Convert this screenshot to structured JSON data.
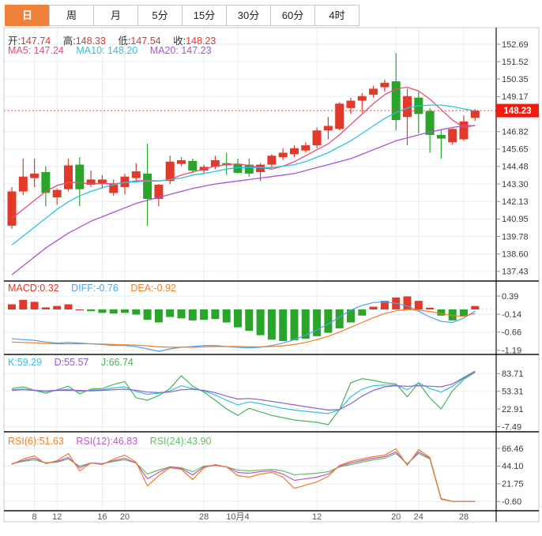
{
  "tabs": [
    {
      "label": "日",
      "active": true
    },
    {
      "label": "周",
      "active": false
    },
    {
      "label": "月",
      "active": false
    },
    {
      "label": "5分",
      "active": false
    },
    {
      "label": "15分",
      "active": false
    },
    {
      "label": "30分",
      "active": false
    },
    {
      "label": "60分",
      "active": false
    },
    {
      "label": "4时",
      "active": false
    }
  ],
  "header": {
    "open_label": "开:",
    "open": "147.74",
    "high_label": "高:",
    "high": "148.33",
    "low_label": "低:",
    "low": "147.54",
    "close_label": "收:",
    "close": "148.23",
    "ma5_label": "MA5: ",
    "ma5": "147.24",
    "ma10_label": "MA10: ",
    "ma10": "148.20",
    "ma20_label": "MA20: ",
    "ma20": "147.23"
  },
  "indicators": {
    "macd": "MACD:0.32",
    "diff": "DIFF:-0.76",
    "dea": "DEA:-0.92",
    "k": "K:59.29",
    "d": "D:55.57",
    "j": "J:66.74",
    "rsi6": "RSI(6):51.63",
    "rsi12": "RSI(12):46.83",
    "rsi24": "RSI(24):43.90"
  },
  "colors": {
    "up": "#e13a2b",
    "down": "#2aa52a",
    "ma5": "#ec4a71",
    "ma10": "#27c4e2",
    "ma20": "#ad52d6",
    "diff": "#4da2ee",
    "dea": "#f57b1f",
    "macd_text": "#e8312a",
    "k": "#2fc2de",
    "d": "#8a5fd0",
    "j": "#4cb05c",
    "rsi6": "#f07e28",
    "rsi12": "#bb58c9",
    "rsi24": "#69bd69",
    "badge": "#ee1c0f",
    "price_line": "#e84040",
    "grid": "#e3edf3",
    "frame": "#c9c9c9",
    "separator": "#111111",
    "axis_text": "#3a3a3a",
    "xaxis_text": "#555555",
    "ohlc_label": "#333333",
    "ohlc_value": "#e8312a",
    "tab_active_bg": "#ef8138",
    "macd_zero": "#a8d8ea"
  },
  "chart_data": {
    "type": "candlestick",
    "price_line": "148.23",
    "candles": [
      [
        140.5,
        143.1,
        140.3,
        142.8
      ],
      [
        142.8,
        145.0,
        142.55,
        143.8
      ],
      [
        143.7,
        145.0,
        143.1,
        144.0
      ],
      [
        144.1,
        144.5,
        141.8,
        142.7
      ],
      [
        142.4,
        143.0,
        141.9,
        142.9
      ],
      [
        142.95,
        145.0,
        142.8,
        144.55
      ],
      [
        144.6,
        145.1,
        141.8,
        142.95
      ],
      [
        143.25,
        144.2,
        143.1,
        143.6
      ],
      [
        143.3,
        143.9,
        143.0,
        143.6
      ],
      [
        142.7,
        143.6,
        142.5,
        143.35
      ],
      [
        143.1,
        144.0,
        142.6,
        143.8
      ],
      [
        143.7,
        144.7,
        143.4,
        144.15
      ],
      [
        144.0,
        146.0,
        140.5,
        142.3
      ],
      [
        142.3,
        143.3,
        141.8,
        143.25
      ],
      [
        143.5,
        145.2,
        143.3,
        144.8
      ],
      [
        144.65,
        145.1,
        144.5,
        144.9
      ],
      [
        144.85,
        145.0,
        144.1,
        144.2
      ],
      [
        144.2,
        144.6,
        144.0,
        144.45
      ],
      [
        144.45,
        145.2,
        144.3,
        144.9
      ],
      [
        144.7,
        145.4,
        143.9,
        144.55
      ],
      [
        144.65,
        145.0,
        144.0,
        144.05
      ],
      [
        144.6,
        145.0,
        143.8,
        144.0
      ],
      [
        144.1,
        144.7,
        143.5,
        144.6
      ],
      [
        144.6,
        145.3,
        144.4,
        145.2
      ],
      [
        145.1,
        145.7,
        144.9,
        145.4
      ],
      [
        145.3,
        145.9,
        145.1,
        145.7
      ],
      [
        145.55,
        146.1,
        145.4,
        145.9
      ],
      [
        145.9,
        147.1,
        145.7,
        146.9
      ],
      [
        146.9,
        147.8,
        146.3,
        147.2
      ],
      [
        147.0,
        148.8,
        146.9,
        148.7
      ],
      [
        148.4,
        149.1,
        148.0,
        148.9
      ],
      [
        148.9,
        149.4,
        148.1,
        149.2
      ],
      [
        149.3,
        149.9,
        149.1,
        149.7
      ],
      [
        149.8,
        150.3,
        149.5,
        150.1
      ],
      [
        150.2,
        152.1,
        146.9,
        147.6
      ],
      [
        147.8,
        149.7,
        145.9,
        149.2
      ],
      [
        149.1,
        149.5,
        146.7,
        148.0
      ],
      [
        148.2,
        148.4,
        145.4,
        146.6
      ],
      [
        146.6,
        146.9,
        145.0,
        146.35
      ],
      [
        146.1,
        147.05,
        145.95,
        147.0
      ],
      [
        146.3,
        147.9,
        146.2,
        147.5
      ],
      [
        147.74,
        148.33,
        147.54,
        148.23
      ]
    ],
    "ma5": [
      141.0,
      141.6,
      142.2,
      142.8,
      143.2,
      143.4,
      143.4,
      143.3,
      143.35,
      143.3,
      143.4,
      143.5,
      143.55,
      143.5,
      143.6,
      143.9,
      144.1,
      144.3,
      144.5,
      144.6,
      144.65,
      144.55,
      144.4,
      144.3,
      144.5,
      144.8,
      145.2,
      145.6,
      146.0,
      146.6,
      147.3,
      148.0,
      148.7,
      149.3,
      149.7,
      149.8,
      149.55,
      149.0,
      148.3,
      147.6,
      147.1,
      147.24
    ],
    "ma10": [
      139.2,
      139.8,
      140.4,
      141.0,
      141.6,
      142.1,
      142.5,
      142.8,
      143.05,
      143.25,
      143.4,
      143.45,
      143.5,
      143.5,
      143.6,
      143.7,
      143.9,
      144.0,
      144.15,
      144.3,
      144.4,
      144.4,
      144.4,
      144.4,
      144.5,
      144.6,
      144.8,
      145.1,
      145.4,
      145.8,
      146.2,
      146.7,
      147.2,
      147.7,
      148.1,
      148.4,
      148.55,
      148.6,
      148.6,
      148.5,
      148.35,
      148.2
    ],
    "ma20": [
      137.2,
      137.8,
      138.4,
      139.0,
      139.5,
      140.0,
      140.4,
      140.8,
      141.1,
      141.4,
      141.7,
      142.0,
      142.2,
      142.4,
      142.6,
      142.8,
      143.0,
      143.15,
      143.3,
      143.4,
      143.5,
      143.6,
      143.7,
      143.8,
      143.9,
      144.0,
      144.2,
      144.4,
      144.6,
      144.8,
      145.0,
      145.3,
      145.6,
      145.9,
      146.2,
      146.4,
      146.6,
      146.8,
      146.95,
      147.1,
      147.2,
      147.23
    ],
    "main_ticks": [
      "152.69",
      "151.52",
      "150.35",
      "149.17",
      "146.82",
      "145.65",
      "144.48",
      "143.30",
      "142.13",
      "140.95",
      "139.78",
      "138.60",
      "137.43"
    ],
    "macd": {
      "hist": [
        0.15,
        0.28,
        0.22,
        0.06,
        0.1,
        0.15,
        0.0,
        -0.05,
        -0.1,
        -0.12,
        -0.1,
        -0.15,
        -0.3,
        -0.38,
        -0.22,
        -0.26,
        -0.32,
        -0.3,
        -0.28,
        -0.38,
        -0.52,
        -0.62,
        -0.75,
        -0.88,
        -0.92,
        -0.9,
        -0.85,
        -0.78,
        -0.68,
        -0.55,
        -0.38,
        -0.18,
        0.08,
        0.25,
        0.35,
        0.38,
        0.25,
        0.05,
        -0.18,
        -0.32,
        -0.2,
        0.1
      ],
      "diff": [
        -0.85,
        -0.88,
        -0.9,
        -0.95,
        -0.98,
        -0.96,
        -0.98,
        -1.0,
        -1.02,
        -1.05,
        -1.05,
        -1.08,
        -1.15,
        -1.22,
        -1.15,
        -1.1,
        -1.08,
        -1.05,
        -1.05,
        -1.08,
        -1.1,
        -1.12,
        -1.1,
        -1.05,
        -0.98,
        -0.88,
        -0.75,
        -0.6,
        -0.42,
        -0.22,
        -0.02,
        0.12,
        0.2,
        0.22,
        0.18,
        0.1,
        -0.05,
        -0.22,
        -0.35,
        -0.38,
        -0.25,
        -0.05
      ],
      "dea": [
        -0.95,
        -0.96,
        -0.97,
        -0.99,
        -1.0,
        -1.0,
        -1.0,
        -1.0,
        -1.01,
        -1.02,
        -1.03,
        -1.04,
        -1.06,
        -1.09,
        -1.1,
        -1.1,
        -1.1,
        -1.09,
        -1.08,
        -1.08,
        -1.08,
        -1.09,
        -1.09,
        -1.08,
        -1.06,
        -1.02,
        -0.96,
        -0.88,
        -0.78,
        -0.66,
        -0.52,
        -0.38,
        -0.24,
        -0.12,
        -0.04,
        0.0,
        -0.02,
        -0.06,
        -0.12,
        -0.18,
        -0.2,
        -0.12
      ],
      "ticks": [
        "0.39",
        "-0.14",
        "-0.66",
        "-1.19"
      ]
    },
    "kdj": {
      "k": [
        56,
        57,
        55,
        53,
        55,
        57,
        53,
        55,
        56,
        59,
        61,
        53,
        48,
        50,
        54,
        63,
        58,
        54,
        47,
        38,
        30,
        35,
        32,
        28,
        24,
        21,
        19,
        17,
        15,
        22,
        44,
        57,
        63,
        64,
        64,
        56,
        68,
        58,
        52,
        62,
        76,
        87
      ],
      "d": [
        55,
        56,
        55,
        54,
        55,
        55,
        55,
        54,
        55,
        56,
        57,
        55,
        52,
        51,
        52,
        56,
        57,
        55,
        51,
        45,
        40,
        41,
        39,
        36,
        33,
        30,
        27,
        24,
        21,
        22,
        32,
        45,
        55,
        61,
        63,
        62,
        63,
        62,
        61,
        66,
        77,
        88
      ],
      "j": [
        58,
        61,
        55,
        50,
        56,
        62,
        49,
        57,
        58,
        65,
        70,
        42,
        38,
        46,
        58,
        80,
        62,
        52,
        38,
        23,
        12,
        24,
        18,
        12,
        8,
        4,
        2,
        0,
        -4,
        22,
        68,
        75,
        72,
        68,
        66,
        44,
        68,
        42,
        23,
        54,
        74,
        86
      ],
      "ticks": [
        "83.71",
        "53.31",
        "22.91",
        "-7.49"
      ]
    },
    "rsi": {
      "rsi6": [
        46,
        53,
        57,
        47,
        51,
        60,
        38,
        48,
        46,
        53,
        58,
        49,
        19,
        32,
        42,
        40,
        27,
        42,
        46,
        43,
        32,
        30,
        34,
        36,
        30,
        16,
        20,
        24,
        31,
        45,
        50,
        53,
        56,
        58,
        66,
        45,
        65,
        55,
        3,
        -0.6,
        -0.6,
        -0.6
      ],
      "rsi12": [
        47,
        51,
        54,
        48,
        50,
        55,
        42,
        48,
        47,
        51,
        54,
        48,
        28,
        36,
        43,
        41,
        33,
        43,
        45,
        43,
        36,
        35,
        37,
        38,
        34,
        26,
        28,
        30,
        34,
        44,
        48,
        51,
        54,
        56,
        62,
        46,
        62,
        54,
        2.5,
        -0.6,
        -0.6,
        -0.6
      ],
      "rsi24": [
        47,
        50,
        52,
        48,
        49,
        53,
        44,
        48,
        47,
        50,
        52,
        48,
        34,
        39,
        43,
        42,
        37,
        44,
        45,
        43,
        39,
        38,
        39,
        40,
        38,
        33,
        34,
        35,
        37,
        43,
        46,
        49,
        52,
        54,
        60,
        47,
        60,
        53,
        2,
        -0.6,
        -0.6,
        -0.6
      ],
      "ticks": [
        "66.46",
        "44.10",
        "21.75",
        "-0.60"
      ]
    },
    "x_labels": [
      {
        "index": 2,
        "label": "8"
      },
      {
        "index": 4,
        "label": "12"
      },
      {
        "index": 8,
        "label": "16"
      },
      {
        "index": 10,
        "label": "20"
      },
      {
        "index": 17,
        "label": "28"
      },
      {
        "index": 20,
        "label": "10月4"
      },
      {
        "index": 27,
        "label": "12"
      },
      {
        "index": 34,
        "label": "20"
      },
      {
        "index": 36,
        "label": "24"
      },
      {
        "index": 40,
        "label": "28"
      }
    ]
  }
}
